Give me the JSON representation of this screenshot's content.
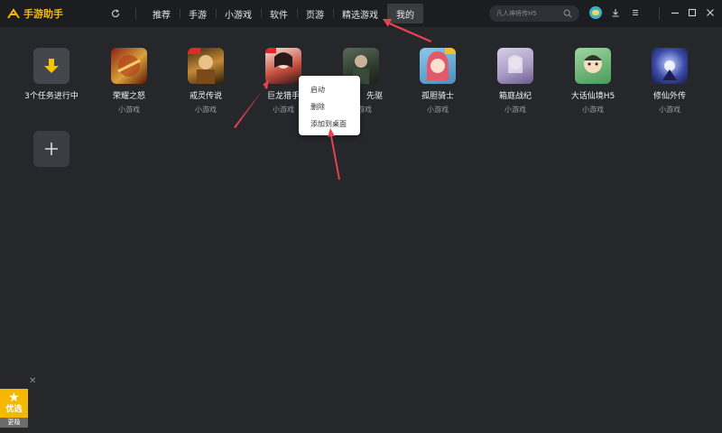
{
  "app": {
    "name": "手游助手",
    "accent": "#f5b800"
  },
  "toolbar": {
    "refresh_icon": "refresh-icon",
    "tabs": [
      {
        "label": "推荐"
      },
      {
        "label": "手游"
      },
      {
        "label": "小游戏"
      },
      {
        "label": "软件"
      },
      {
        "label": "页游"
      },
      {
        "label": "精选游戏"
      },
      {
        "label": "我的",
        "active": true
      }
    ],
    "search_placeholder": "凡人神将传H5"
  },
  "downloads": {
    "label": "3个任务进行中"
  },
  "games": [
    {
      "name": "荣耀之怒",
      "type": "小游戏"
    },
    {
      "name": "戒灵传说",
      "type": "小游戏"
    },
    {
      "name": "巨龙猎手",
      "type": "小游戏"
    },
    {
      "name": "先驱",
      "type": "小游戏"
    },
    {
      "name": "孤胆骑士",
      "type": "小游戏"
    },
    {
      "name": "箱庭战纪",
      "type": "小游戏"
    },
    {
      "name": "大话仙境H5",
      "type": "小游戏"
    },
    {
      "name": "修仙外传",
      "type": "小游戏"
    }
  ],
  "context_menu": {
    "items": [
      {
        "label": "启动"
      },
      {
        "label": "删除"
      },
      {
        "label": "添加到桌面"
      }
    ]
  },
  "promo": {
    "label": "优选",
    "sub": "更隐"
  },
  "colors": {
    "background": "#26272b",
    "topbar": "#1c1d20",
    "annotation_arrow": "#e8414f"
  }
}
